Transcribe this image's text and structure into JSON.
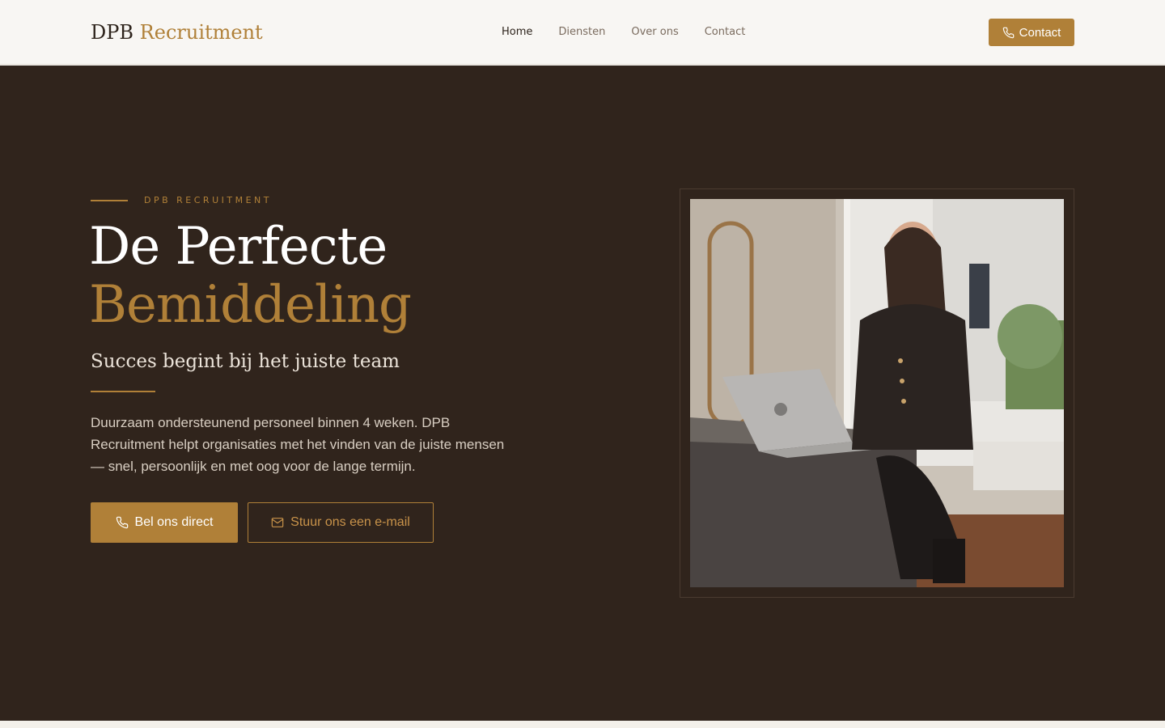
{
  "header": {
    "logo_primary": "DPB",
    "logo_accent": "Recruitment",
    "nav": [
      {
        "label": "Home",
        "active": true
      },
      {
        "label": "Diensten",
        "active": false
      },
      {
        "label": "Over ons",
        "active": false
      },
      {
        "label": "Contact",
        "active": false
      }
    ],
    "cta_label": "Contact",
    "cta_icon": "phone-icon"
  },
  "hero": {
    "eyebrow": "DPB RECRUITMENT",
    "title_line1": "De Perfecte",
    "title_line2": "Bemiddeling",
    "subtitle": "Succes begint bij het juiste team",
    "description": "Duurzaam ondersteunend personeel binnen 4 weken. DPB Recruitment helpt organisaties met het vinden van de juiste mensen — snel, persoonlijk en met oog voor de lange termijn.",
    "primary_button": {
      "label": "Bel ons direct",
      "icon": "phone-icon"
    },
    "secondary_button": {
      "label": "Stuur ons een e-mail",
      "icon": "mail-icon"
    }
  },
  "colors": {
    "accent": "#b08038",
    "hero_background": "#30241c",
    "header_background": "#f8f6f3",
    "text_dark": "#2e241c"
  }
}
